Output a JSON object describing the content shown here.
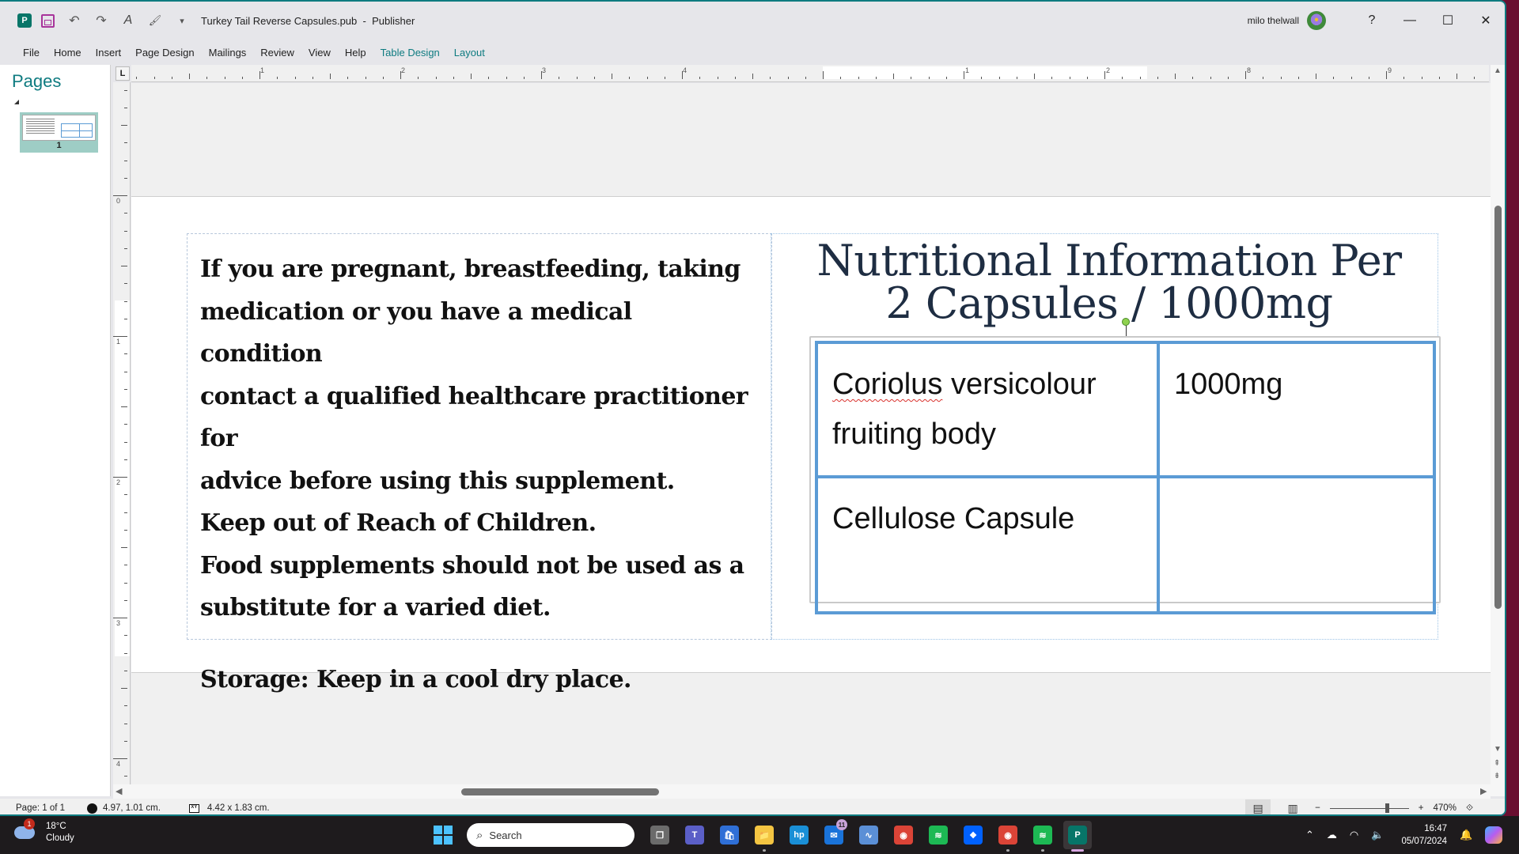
{
  "window": {
    "document_name": "Turkey Tail Reverse Capsules.pub",
    "app_name": "Publisher",
    "title_separator": "-",
    "user_name": "milo thelwall",
    "help_label": "?",
    "quick_access": {
      "app_icon_letter": "P",
      "undo_icon": "↶",
      "redo_icon": "↷",
      "spelling_icon": "A",
      "format_painter_icon": "🖌",
      "customize_icon": "▾"
    },
    "controls": {
      "minimize": "—",
      "maximize": "☐",
      "close": "✕"
    }
  },
  "menu": {
    "items": [
      {
        "label": "File"
      },
      {
        "label": "Home"
      },
      {
        "label": "Insert"
      },
      {
        "label": "Page Design"
      },
      {
        "label": "Mailings"
      },
      {
        "label": "Review"
      },
      {
        "label": "View"
      },
      {
        "label": "Help"
      }
    ],
    "contextual": [
      {
        "label": "Table Design"
      },
      {
        "label": "Layout"
      }
    ]
  },
  "pages_panel": {
    "title": "Pages",
    "pages": [
      {
        "number": "1",
        "selected": true
      }
    ]
  },
  "ruler": {
    "corner_label": "L",
    "horizontal_labels": [
      "1",
      "2",
      "3",
      "4",
      "1",
      "2",
      "8",
      "9"
    ],
    "vertical_labels": [
      "0",
      "1",
      "2",
      "3",
      "4"
    ]
  },
  "document": {
    "warning_lines": [
      "If you are pregnant, breastfeeding, taking",
      "medication or you have a medical condition",
      "contact a qualified healthcare practitioner for",
      "advice before using this supplement.",
      "Keep out of Reach of Children.",
      "Food supplements should not be used as a",
      "substitute for a varied diet."
    ],
    "storage_text": "Storage: Keep in a cool dry place.",
    "nutrition_title_line1": "Nutritional Information Per",
    "nutrition_title_line2": "2 Capsules / 1000mg",
    "table": {
      "rows": [
        {
          "ingredient_word1": "Coriolus",
          "ingredient_rest": " versicolour fruiting body",
          "amount": "1000mg"
        },
        {
          "ingredient_word1": "Cellulose",
          "ingredient_rest": " Capsule",
          "amount": ""
        }
      ]
    }
  },
  "status_bar": {
    "page_info": "Page: 1 of 1",
    "position": "4.97, 1.01 cm.",
    "size_icon_label": "XY",
    "size": "4.42 x   1.83 cm.",
    "zoom_level": "470%",
    "zoom_fraction": 0.72,
    "zoom_minus": "−",
    "zoom_plus": "+",
    "fit_icon": "⟐"
  },
  "taskbar": {
    "weather_temp": "18°C",
    "weather_desc": "Cloudy",
    "weather_badge": "1",
    "search_placeholder": "Search",
    "mail_badge": "11",
    "time": "16:47",
    "date": "05/07/2024",
    "apps": [
      {
        "name": "task-view",
        "glyph": "❐",
        "color": "#6b6b6b"
      },
      {
        "name": "teams",
        "glyph": "T",
        "color": "#5b5fc7"
      },
      {
        "name": "microsoft-store",
        "glyph": "🛍",
        "color": "#2f6fd6"
      },
      {
        "name": "file-explorer",
        "glyph": "📁",
        "color": "#f4c542"
      },
      {
        "name": "hp-app",
        "glyph": "hp",
        "color": "#1a8fd6"
      },
      {
        "name": "mail",
        "glyph": "✉",
        "color": "#1a73d9"
      },
      {
        "name": "resource-monitor",
        "glyph": "∿",
        "color": "#5b8fd6"
      },
      {
        "name": "chrome",
        "glyph": "◉",
        "color": "#db4437"
      },
      {
        "name": "spotify",
        "glyph": "≋",
        "color": "#1db954"
      },
      {
        "name": "dropbox",
        "glyph": "❖",
        "color": "#0061fe"
      },
      {
        "name": "chrome-profile",
        "glyph": "◉",
        "color": "#db4437"
      },
      {
        "name": "spotify-2",
        "glyph": "≋",
        "color": "#1db954"
      },
      {
        "name": "publisher",
        "glyph": "P",
        "color": "#077568"
      }
    ]
  }
}
